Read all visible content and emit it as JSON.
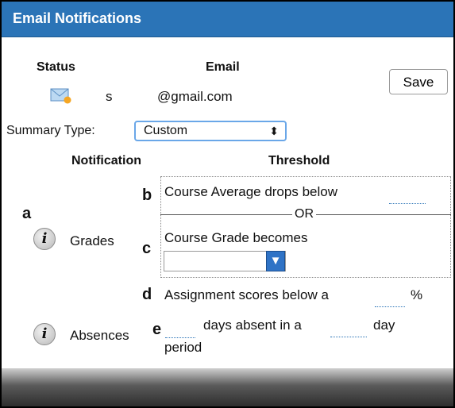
{
  "header": {
    "title": "Email Notifications"
  },
  "columns": {
    "status": "Status",
    "email": "Email"
  },
  "contact": {
    "status_icon": "envelope-icon",
    "status_text": "s",
    "email": "@gmail.com"
  },
  "save_button": {
    "label": "Save"
  },
  "summary": {
    "label": "Summary Type:",
    "selected": "Custom"
  },
  "table": {
    "notification_header": "Notification",
    "threshold_header": "Threshold"
  },
  "annotations": {
    "a": "a",
    "b": "b",
    "c": "c",
    "d": "d",
    "e": "e"
  },
  "grades": {
    "label": "Grades",
    "average_text": "Course Average drops below",
    "average_value": "",
    "or_text": "OR",
    "grade_text": "Course Grade becomes",
    "grade_selected": ""
  },
  "assignments": {
    "text": "Assignment scores below a",
    "value": "",
    "unit": "%"
  },
  "absences": {
    "label": "Absences",
    "days_value": "",
    "text_mid": "days absent in a",
    "period_value": "",
    "text_end": "day",
    "text_wrap": "period"
  },
  "icons": {
    "info": "i"
  },
  "colors": {
    "header_bg": "#2b74b7",
    "accent": "#2f73c6"
  }
}
